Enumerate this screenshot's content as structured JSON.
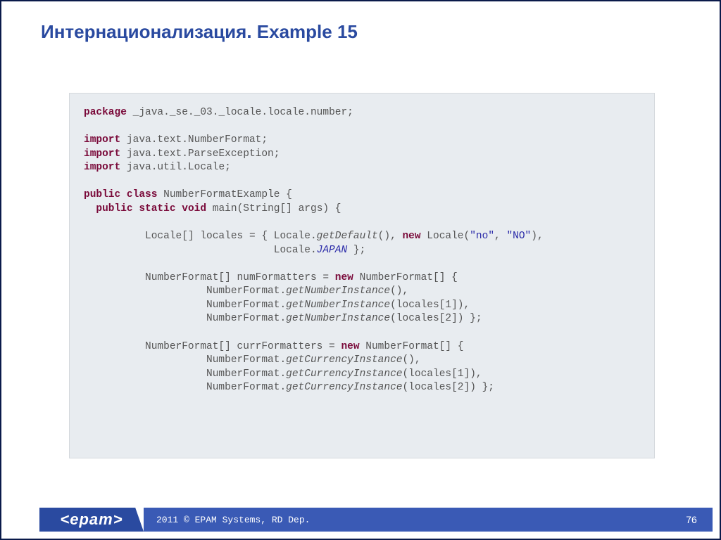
{
  "title": "Интернационализация. Example 15",
  "code": {
    "l1a": "package",
    "l1b": " _java._se._03._locale.locale.number;",
    "l2a": "import",
    "l2b": " java.text.NumberFormat;",
    "l3a": "import",
    "l3b": " java.text.ParseException;",
    "l4a": "import",
    "l4b": " java.util.Locale;",
    "l5a": "public",
    "l5b": " ",
    "l5c": "class",
    "l5d": " NumberFormatExample {",
    "l6a": "  ",
    "l6b": "public",
    "l6c": " ",
    "l6d": "static",
    "l6e": " ",
    "l6f": "void",
    "l6g": " main(String[] args) {",
    "l7a": "          Locale[] locales = { Locale.",
    "l7b": "getDefault",
    "l7c": "(), ",
    "l7d": "new",
    "l7e": " Locale(",
    "l7f": "\"no\"",
    "l7g": ", ",
    "l7h": "\"NO\"",
    "l7i": "),",
    "l8a": "                               Locale.",
    "l8b": "JAPAN",
    "l8c": " };",
    "l9a": "          NumberFormat[] numFormatters = ",
    "l9b": "new",
    "l9c": " NumberFormat[] {",
    "l10a": "                    NumberFormat.",
    "l10b": "getNumberInstance",
    "l10c": "(),",
    "l11a": "                    NumberFormat.",
    "l11b": "getNumberInstance",
    "l11c": "(locales[1]),",
    "l12a": "                    NumberFormat.",
    "l12b": "getNumberInstance",
    "l12c": "(locales[2]) };",
    "l13a": "          NumberFormat[] currFormatters = ",
    "l13b": "new",
    "l13c": " NumberFormat[] {",
    "l14a": "                    NumberFormat.",
    "l14b": "getCurrencyInstance",
    "l14c": "(),",
    "l15a": "                    NumberFormat.",
    "l15b": "getCurrencyInstance",
    "l15c": "(locales[1]),",
    "l16a": "                    NumberFormat.",
    "l16b": "getCurrencyInstance",
    "l16c": "(locales[2]) };"
  },
  "footer": {
    "logo": "<epam>",
    "copyright": "2011 © EPAM Systems, RD Dep.",
    "page": "76"
  }
}
